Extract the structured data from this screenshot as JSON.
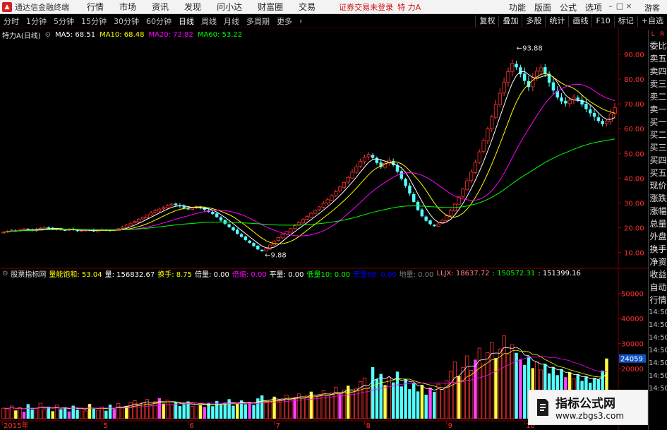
{
  "app": {
    "title": "通达信金融终端",
    "menu": [
      "行情",
      "市场",
      "资讯",
      "发现",
      "问小达",
      "财富圈",
      "交易"
    ],
    "login_notice": "证券交易未登录",
    "stock_name": "特 力A",
    "right_menu": [
      "功能",
      "版面",
      "公式",
      "选项"
    ],
    "guest": "游客"
  },
  "toolbar": {
    "periods": [
      "分时",
      "1分钟",
      "5分钟",
      "15分钟",
      "30分钟",
      "60分钟",
      "日线",
      "周线",
      "月线",
      "多周期",
      "更多"
    ],
    "active_period": "日线",
    "tools": [
      "复权",
      "叠加",
      "多股",
      "统计",
      "画线",
      "F10",
      "标记",
      "+自选"
    ]
  },
  "ma_info": {
    "label": "特力A(日线)",
    "ma5": "MA5: 68.51",
    "ma10": "MA10: 68.48",
    "ma20": "MA20: 72.82",
    "ma60": "MA60: 53.22",
    "colors": {
      "ma5": "#ffffff",
      "ma10": "#ffff00",
      "ma20": "#ff00ff",
      "ma60": "#00ff00"
    }
  },
  "price_axis": {
    "labels": [
      "90.00",
      "80.00",
      "70.00",
      "60.00",
      "50.00",
      "40.00",
      "30.00",
      "20.00",
      "10.00"
    ]
  },
  "annotations": {
    "high": "93.88",
    "low": "9.88"
  },
  "indicator_info": {
    "name": "股票指标网",
    "items": [
      {
        "text": "量能饱和: 53.04",
        "color": "#ffff00"
      },
      {
        "text": "量: 156832.67",
        "color": "#ffffff"
      },
      {
        "text": "换手: 8.75",
        "color": "#ffff00"
      },
      {
        "text": "倍量: 0.00",
        "color": "#ffffff"
      },
      {
        "text": "倍缩: 0.00",
        "color": "#ff00ff"
      },
      {
        "text": "平量: 0.00",
        "color": "#ffffff"
      },
      {
        "text": "低量10: 0.00",
        "color": "#00ff00"
      },
      {
        "text": "无量69: 0.00",
        "color": "#0000ff"
      },
      {
        "text": "地量: 0.00",
        "color": "#808080"
      },
      {
        "text": "LLJX: 18637.72",
        "color": "#ff8080"
      },
      {
        "text": ": 150572.31",
        "color": "#00ff00"
      },
      {
        "text": ": 151399.16",
        "color": "#ffffff"
      }
    ]
  },
  "volume_axis": {
    "labels": [
      "50000",
      "40000",
      "30000",
      "20000"
    ],
    "current": "24059"
  },
  "date_axis": {
    "labels": [
      "2015年",
      "5",
      "6",
      "7",
      "8",
      "9",
      "10"
    ]
  },
  "side_panel": {
    "top_labels": [
      "L",
      "R"
    ],
    "items": [
      "委比",
      "卖五",
      "卖四",
      "卖三",
      "卖二",
      "卖一",
      "买一",
      "买二",
      "买三",
      "买四",
      "买五",
      "现价",
      "涨跌",
      "涨幅",
      "总量",
      "外盘",
      "换手",
      "净资",
      "收益",
      "自动",
      "行情",
      "14:50",
      "14:50",
      "14:50",
      "14:50",
      "14:50",
      "14:50",
      "14:50"
    ]
  },
  "watermark": {
    "title": "指标公式网",
    "url": "www.zbgs3.com"
  },
  "chart_data": {
    "type": "candlestick",
    "series_desc": "daily candles with MA5/MA10/MA20/MA60 and volume",
    "price_range": [
      5,
      96
    ],
    "closes": [
      18.2,
      18.5,
      19.0,
      18.7,
      19.2,
      19.5,
      19.1,
      18.8,
      19.4,
      19.8,
      20.1,
      19.7,
      19.3,
      19.6,
      19.2,
      18.9,
      19.3,
      19.0,
      18.6,
      18.9,
      19.2,
      18.8,
      18.5,
      18.9,
      19.3,
      19.0,
      18.7,
      19.1,
      19.6,
      20.2,
      21.0,
      21.8,
      22.5,
      23.4,
      24.2,
      25.1,
      26.0,
      26.8,
      27.5,
      28.2,
      28.9,
      29.5,
      29.1,
      28.6,
      28.0,
      27.4,
      27.9,
      28.5,
      28.0,
      27.2,
      26.4,
      25.5,
      24.3,
      22.9,
      21.6,
      20.2,
      18.9,
      17.5,
      16.3,
      15.0,
      13.8,
      12.5,
      11.2,
      10.5,
      11.5,
      13.0,
      14.6,
      16.0,
      17.3,
      18.4,
      19.6,
      20.8,
      22.0,
      23.3,
      24.5,
      25.8,
      27.0,
      28.4,
      29.8,
      31.3,
      32.9,
      34.6,
      36.4,
      38.3,
      40.3,
      42.4,
      44.6,
      46.8,
      48.5,
      49.6,
      48.2,
      46.1,
      44.5,
      46.0,
      47.2,
      45.3,
      42.6,
      39.8,
      36.9,
      33.8,
      30.4,
      27.1,
      24.6,
      22.8,
      21.4,
      20.6,
      21.5,
      23.0,
      24.8,
      27.0,
      29.5,
      32.4,
      35.6,
      38.9,
      42.5,
      46.4,
      50.6,
      55.1,
      59.9,
      64.8,
      69.6,
      74.3,
      78.8,
      83.0,
      86.4,
      84.8,
      82.0,
      79.3,
      76.8,
      80.5,
      83.2,
      84.6,
      82.3,
      78.6,
      75.4,
      72.6,
      71.0,
      70.2,
      71.5,
      72.8,
      71.6,
      69.8,
      67.9,
      66.2,
      64.8,
      63.1,
      61.8,
      63.0,
      66.0,
      68.5
    ],
    "volumes": [
      4200,
      3900,
      5100,
      3300,
      4500,
      2800,
      5800,
      3700,
      4100,
      6200,
      3500,
      4800,
      3000,
      5500,
      3800,
      4600,
      2900,
      5200,
      3600,
      4300,
      3100,
      5900,
      4000,
      3400,
      4700,
      3200,
      5600,
      3900,
      6100,
      4400,
      5000,
      6600,
      7200,
      5900,
      6400,
      7700,
      5300,
      6800,
      8200,
      6000,
      7400,
      5700,
      6500,
      5100,
      5800,
      6900,
      4900,
      6200,
      5400,
      4700,
      6300,
      5000,
      7100,
      5600,
      6400,
      7800,
      5200,
      6100,
      7300,
      5800,
      6700,
      5500,
      8100,
      9300,
      6600,
      7400,
      8800,
      7000,
      8000,
      9500,
      7600,
      8600,
      9900,
      8200,
      9300,
      10800,
      8700,
      9700,
      11200,
      9100,
      10300,
      12600,
      9800,
      11500,
      13200,
      10400,
      12100,
      14800,
      16300,
      12000,
      20600,
      15800,
      17900,
      13400,
      16600,
      14500,
      18800,
      12900,
      15700,
      11800,
      14300,
      10900,
      13500,
      9600,
      12400,
      10700,
      13800,
      11600,
      15200,
      18900,
      22700,
      17000,
      20500,
      25100,
      19300,
      23600,
      28200,
      21800,
      26400,
      30500,
      24200,
      27900,
      33100,
      25700,
      29600,
      26300,
      23800,
      21500,
      24900,
      20200,
      22800,
      19500,
      21900,
      18100,
      20700,
      17400,
      19800,
      16600,
      18500,
      15900,
      17700,
      15100,
      16900,
      14400,
      16300,
      15700,
      19200,
      24059
    ]
  }
}
